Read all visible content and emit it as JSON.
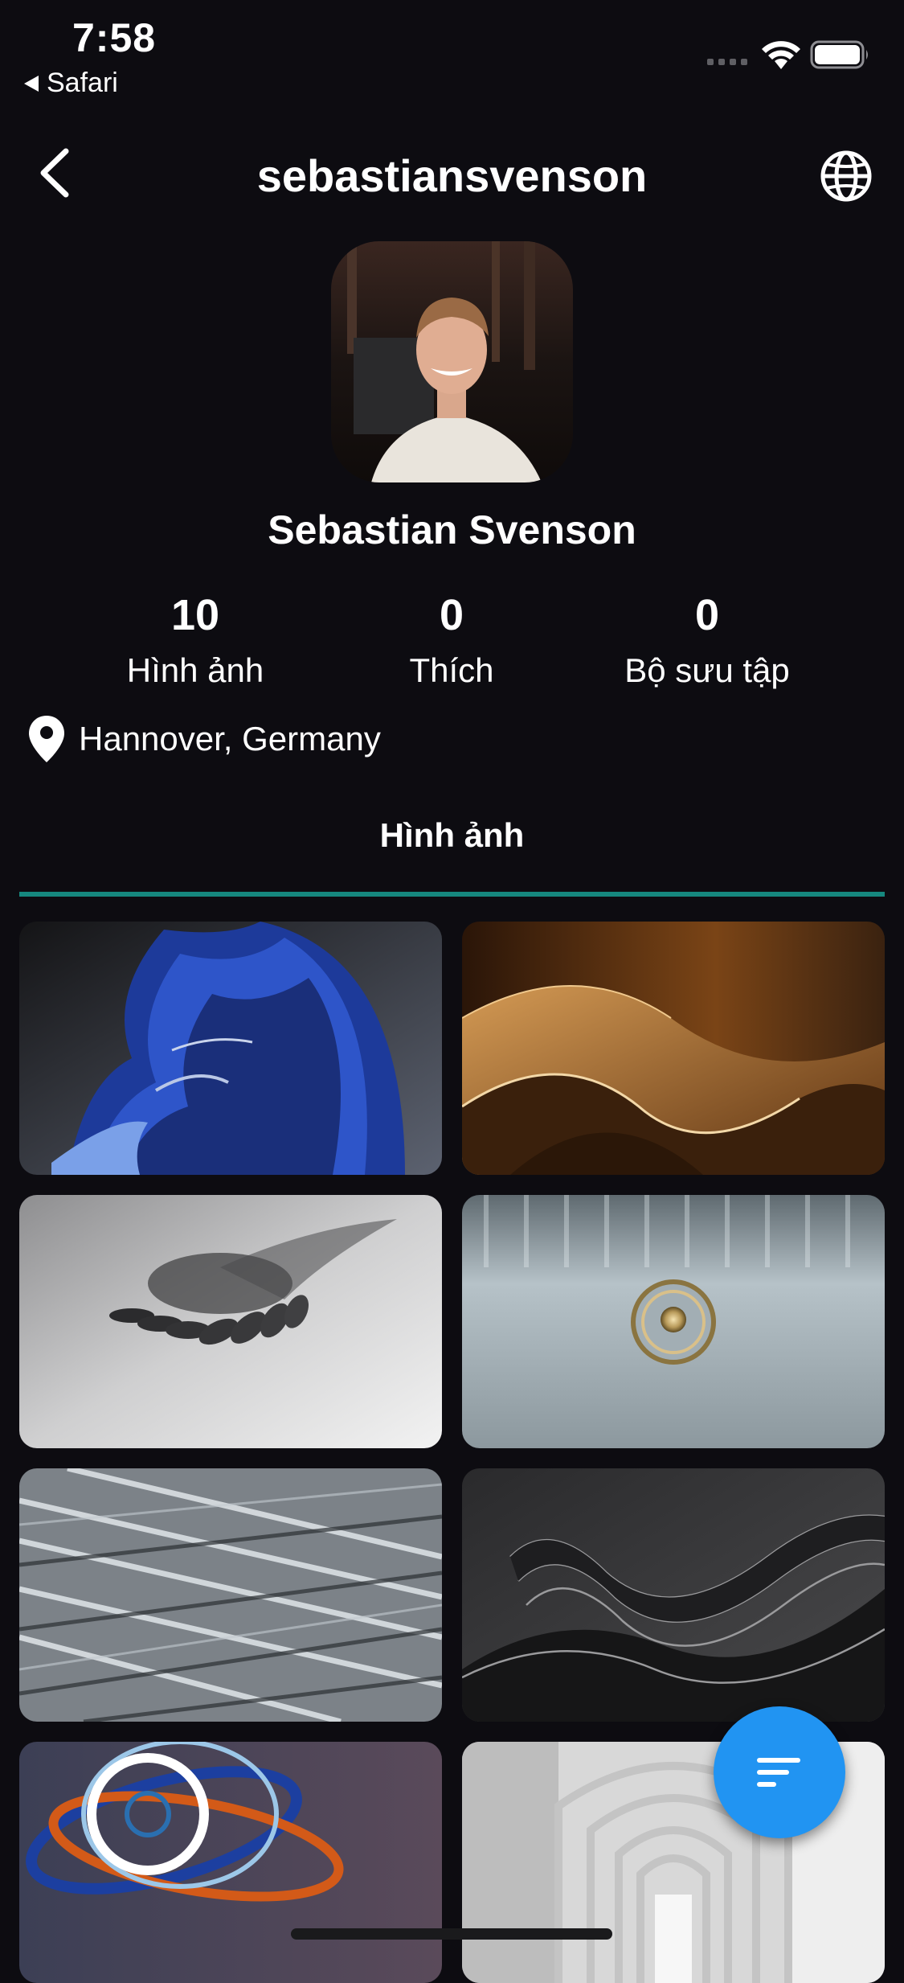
{
  "status_bar": {
    "time": "7:58",
    "back_app": "Safari"
  },
  "header": {
    "title": "sebastiansvenson",
    "back_icon": "chevron-left-icon",
    "globe_icon": "globe-icon"
  },
  "profile": {
    "name": "Sebastian Svenson",
    "location": "Hannover, Germany",
    "stats": [
      {
        "value": "10",
        "label": "Hình ảnh"
      },
      {
        "value": "0",
        "label": "Thích"
      },
      {
        "value": "0",
        "label": "Bộ sưu tập"
      }
    ]
  },
  "tabs": {
    "active": "Hình ảnh"
  },
  "colors": {
    "background": "#0d0c11",
    "tab_indicator": "#16887f",
    "fab": "#2194f2"
  },
  "fab": {
    "icon": "sort-icon"
  }
}
